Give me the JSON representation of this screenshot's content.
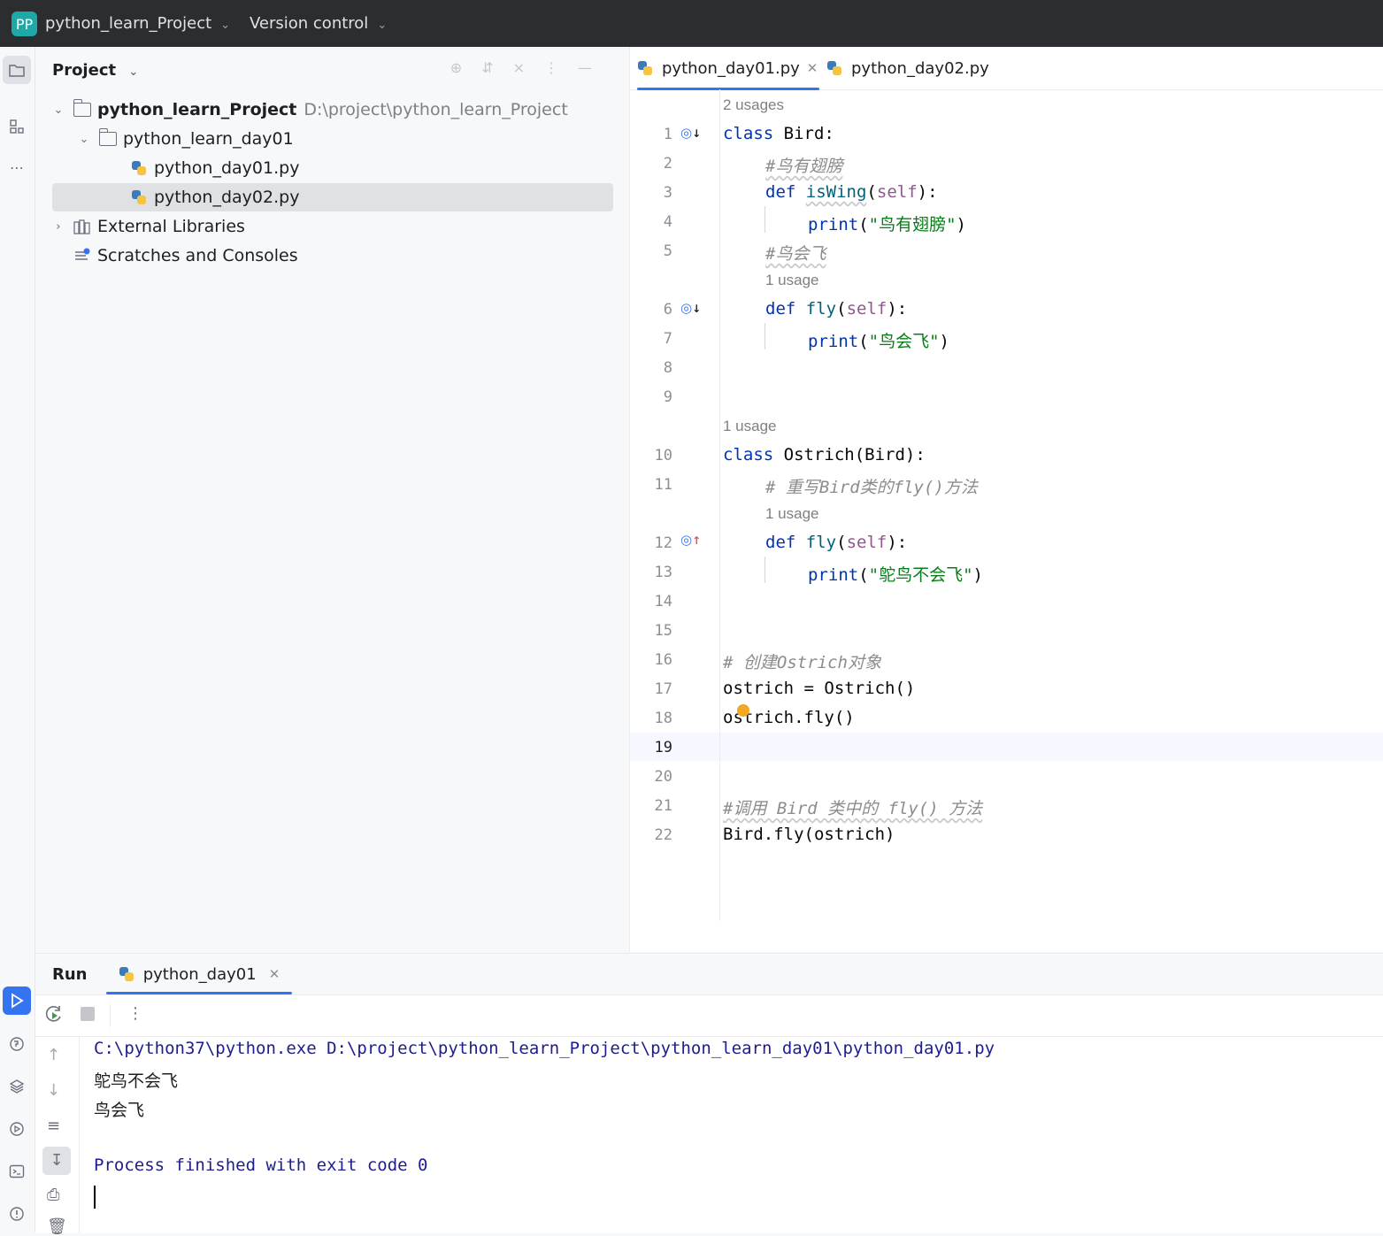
{
  "titlebar": {
    "project_badge": "PP",
    "project_name": "python_learn_Project",
    "vcs_label": "Version control"
  },
  "left_strip_icons": [
    "folder-icon",
    "structure-icon",
    "more-icon",
    "run-icon",
    "python-console-icon",
    "layers-icon",
    "services-icon",
    "terminal-icon",
    "problems-icon"
  ],
  "project_panel": {
    "title": "Project",
    "tree": [
      {
        "label": "python_learn_Project",
        "path": "D:\\project\\python_learn_Project",
        "type": "folder",
        "expanded": true
      },
      {
        "label": "python_learn_day01",
        "type": "folder",
        "expanded": true
      },
      {
        "label": "python_day01.py",
        "type": "python-file"
      },
      {
        "label": "python_day02.py",
        "type": "python-file",
        "selected": true
      },
      {
        "label": "External Libraries",
        "type": "library"
      },
      {
        "label": "Scratches and Consoles",
        "type": "scratches"
      }
    ]
  },
  "editor": {
    "tabs": [
      {
        "label": "python_day01.py",
        "active": true
      },
      {
        "label": "python_day02.py",
        "active": false
      }
    ],
    "current_line": "19",
    "hints": [
      "2 usages",
      "1 usage",
      "1 usage",
      "1 usage"
    ],
    "line_numbers": [
      "1",
      "2",
      "3",
      "4",
      "5",
      "6",
      "7",
      "8",
      "9",
      "10",
      "11",
      "12",
      "13",
      "14",
      "15",
      "16",
      "17",
      "18",
      "19",
      "20",
      "21",
      "22"
    ],
    "code": {
      "l1_kw": "class",
      "l1_rest": " Bird:",
      "l2_cmt": "#鸟有翅膀",
      "l3_kw": "def",
      "l3_fn": "isWing",
      "l3_self": "self",
      "l3_open": "(",
      "l3_close": "):",
      "l4_fn": "print",
      "l4_str": "\"鸟有翅膀\"",
      "l5_cmt": "#鸟会飞",
      "l6_kw": "def",
      "l6_fn": "fly",
      "l6_self": "self",
      "l7_fn": "print",
      "l7_str": "\"鸟会飞\"",
      "l10_kw": "class",
      "l10_rest": " Ostrich(Bird):",
      "l11_cmt": "# 重写Bird类的fly()方法",
      "l12_kw": "def",
      "l12_fn": "fly",
      "l12_self": "self",
      "l13_fn": "print",
      "l13_str": "\"鸵鸟不会飞\"",
      "l16_cmt": "# 创建Ostrich对象",
      "l17": "ostrich = Ostrich()",
      "l18": "ostrich.fly()",
      "l21_cmt": "#调用 Bird 类中的 fly() 方法",
      "l22": "Bird.fly(ostrich)"
    }
  },
  "run_panel": {
    "title": "Run",
    "tab_label": "python_day01",
    "console": [
      "C:\\python37\\python.exe D:\\project\\python_learn_Project\\python_learn_day01\\python_day01.py",
      "鸵鸟不会飞",
      "鸟会飞",
      "",
      "Process finished with exit code 0"
    ]
  }
}
